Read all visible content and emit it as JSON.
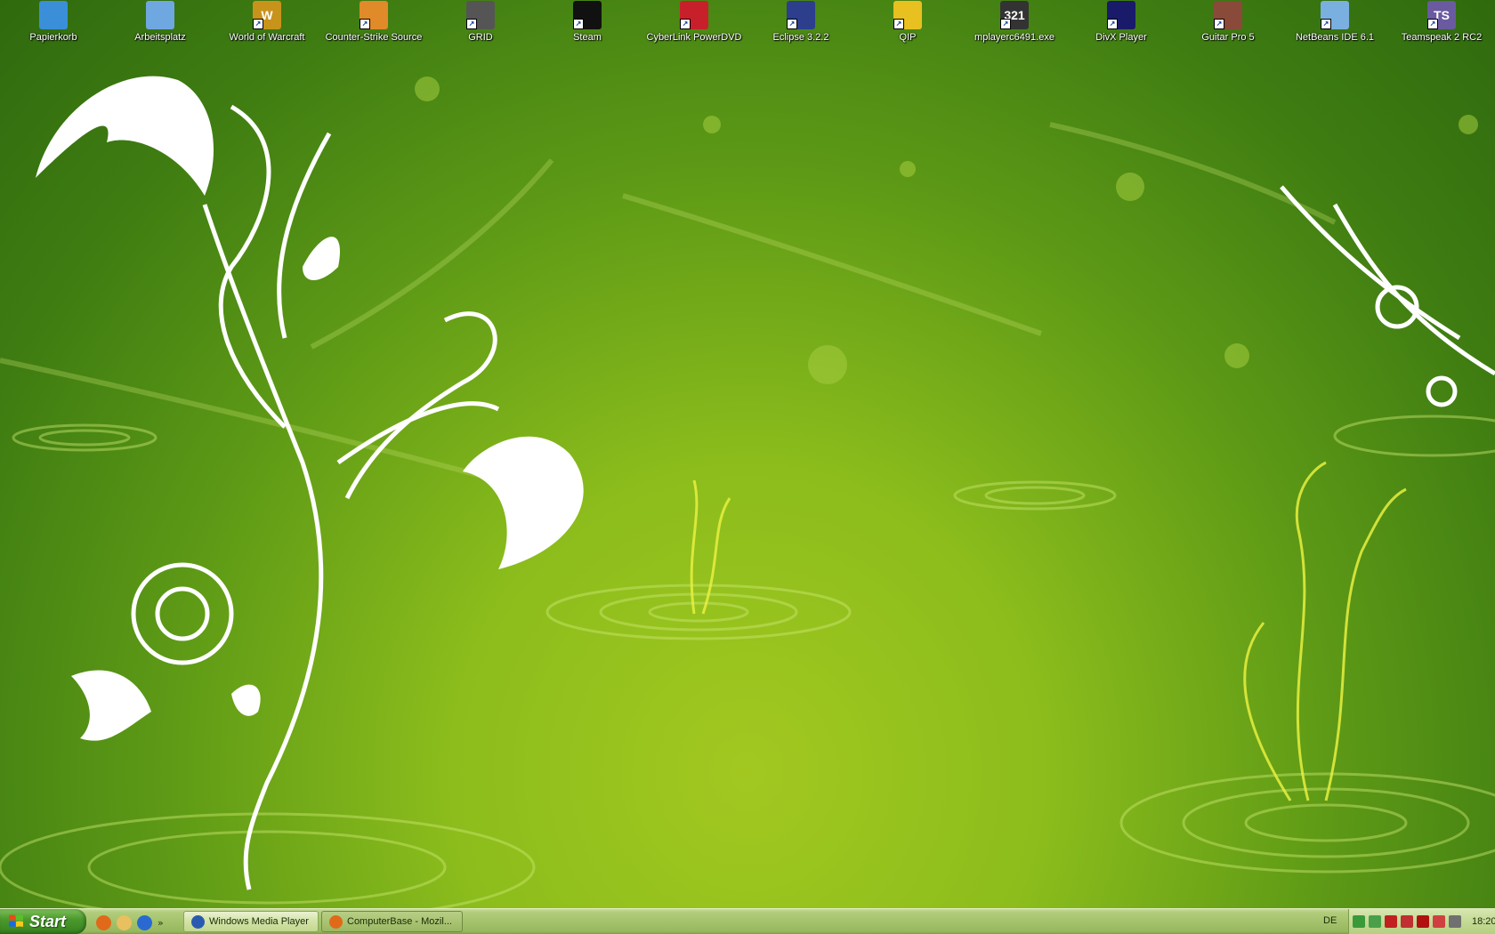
{
  "desktop": {
    "icons": [
      {
        "label": "Papierkorb",
        "icon": "recycle-bin-icon",
        "color": "#3a8fd8"
      },
      {
        "label": "Arbeitsplatz",
        "icon": "my-computer-icon",
        "color": "#6fa8e0"
      },
      {
        "label": "World of Warcraft",
        "icon": "wow-icon",
        "color": "#c8931a",
        "glyph": "W"
      },
      {
        "label": "Counter-Strike Source",
        "icon": "cs-source-icon",
        "color": "#e08a2a"
      },
      {
        "label": "GRID",
        "icon": "grid-icon",
        "color": "#555555"
      },
      {
        "label": "Steam",
        "icon": "steam-icon",
        "color": "#111111"
      },
      {
        "label": "CyberLink PowerDVD",
        "icon": "powerdvd-icon",
        "color": "#c8202a"
      },
      {
        "label": "Eclipse 3.2.2",
        "icon": "eclipse-icon",
        "color": "#2c3e8c"
      },
      {
        "label": "QIP",
        "icon": "qip-icon",
        "color": "#e8c020"
      },
      {
        "label": "mplayerc6491.exe",
        "icon": "media-player-classic-icon",
        "color": "#333333",
        "glyph": "321"
      },
      {
        "label": "DivX Player",
        "icon": "divx-icon",
        "color": "#1a1a6a"
      },
      {
        "label": "Guitar Pro 5",
        "icon": "guitar-pro-icon",
        "color": "#8a4a3a"
      },
      {
        "label": "NetBeans IDE 6.1",
        "icon": "netbeans-icon",
        "color": "#7ab0e0"
      },
      {
        "label": "Teamspeak 2 RC2",
        "icon": "teamspeak-icon",
        "color": "#6a5aa0",
        "glyph": "TS"
      }
    ]
  },
  "taskbar": {
    "start_label": "Start",
    "quicklaunch": [
      {
        "icon": "firefox-icon",
        "color": "#e06a1a"
      },
      {
        "icon": "folder-icon",
        "color": "#e8c060"
      },
      {
        "icon": "internet-explorer-icon",
        "color": "#2a6ad0"
      }
    ],
    "quicklaunch_more": "»",
    "tasks": [
      {
        "label": "Windows Media Player",
        "icon": "windows-media-player-icon",
        "color": "#2a5ab0"
      },
      {
        "label": "ComputerBase - Mozil...",
        "icon": "firefox-icon",
        "color": "#e06a1a"
      }
    ],
    "language": "DE",
    "tray_icons": [
      {
        "icon": "user-icon",
        "color": "#3a9a3a"
      },
      {
        "icon": "network-icon",
        "color": "#4aa04a"
      },
      {
        "icon": "antivirus-icon",
        "color": "#c02020"
      },
      {
        "icon": "security-icon",
        "color": "#c03030"
      },
      {
        "icon": "acrobat-icon",
        "color": "#b01010"
      },
      {
        "icon": "flag-icon",
        "color": "#d04040"
      },
      {
        "icon": "volume-icon",
        "color": "#707070"
      }
    ],
    "clock": "18:20"
  }
}
